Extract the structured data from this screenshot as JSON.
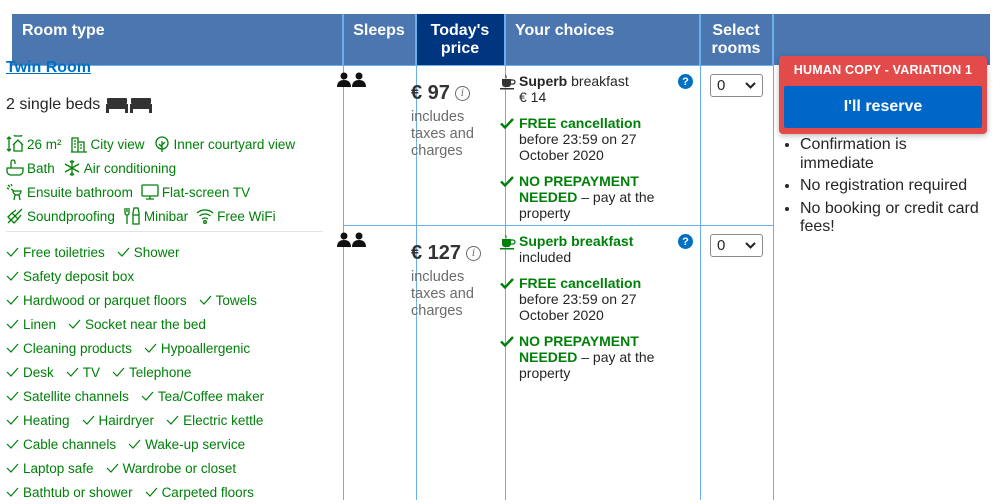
{
  "header": {
    "room_type": "Room type",
    "sleeps": "Sleeps",
    "todays_price": "Today's price",
    "your_choices": "Your choices",
    "select_rooms": "Select rooms"
  },
  "room": {
    "name": "Twin Room",
    "beds": "2 single beds",
    "facilities": [
      [
        "26 m²",
        "City view",
        "Inner courtyard view"
      ],
      [
        "Bath",
        "Air conditioning"
      ],
      [
        "Ensuite bathroom",
        "Flat-screen TV"
      ],
      [
        "Soundproofing",
        "Minibar",
        "Free WiFi"
      ]
    ],
    "amenities": [
      [
        "Free toiletries",
        "Shower"
      ],
      [
        "Safety deposit box"
      ],
      [
        "Hardwood or parquet floors",
        "Towels"
      ],
      [
        "Linen",
        "Socket near the bed"
      ],
      [
        "Cleaning products",
        "Hypoallergenic"
      ],
      [
        "Desk",
        "TV",
        "Telephone"
      ],
      [
        "Satellite channels",
        "Tea/Coffee maker"
      ],
      [
        "Heating",
        "Hairdryer",
        "Electric kettle"
      ],
      [
        "Cable channels",
        "Wake-up service"
      ],
      [
        "Laptop safe",
        "Wardrobe or closet"
      ],
      [
        "Bathtub or shower",
        "Carpeted floors"
      ]
    ]
  },
  "options": [
    {
      "price": "€ 97",
      "price_note": "includes taxes and charges",
      "breakfast_bold": "Superb",
      "breakfast_rest": " breakfast",
      "breakfast_sub": "€ 14",
      "cancel_title": "FREE cancellation",
      "cancel_detail": "before 23:59 on 27 October 2020",
      "prepay_title": "NO PREPAYMENT NEEDED",
      "prepay_detail": " – pay at the property",
      "rooms_selected": "0"
    },
    {
      "price": "€ 127",
      "price_note": "includes taxes and charges",
      "breakfast_bold": "Superb breakfast",
      "breakfast_rest": "",
      "breakfast_sub": "included",
      "cancel_title": "FREE cancellation",
      "cancel_detail": "before 23:59 on 27 October 2020",
      "prepay_title": "NO PREPAYMENT NEEDED",
      "prepay_detail": " – pay at the property",
      "rooms_selected": "0"
    }
  ],
  "cta": {
    "variant_label": "HUMAN COPY - VARIATION 1",
    "reserve_label": "I'll reserve",
    "benefits": [
      "Confirmation is immediate",
      "No registration required",
      "No booking or credit card fees!"
    ]
  },
  "icons": {
    "help": "?",
    "info": "i"
  },
  "colors": {
    "header_bg": "#4b76b0",
    "header_highlight": "#003580",
    "link": "#0071c2",
    "green": "#008009",
    "variant_red": "#e34b4b",
    "reserve_blue": "#0067c8",
    "grid_line": "#6aaeeb"
  }
}
